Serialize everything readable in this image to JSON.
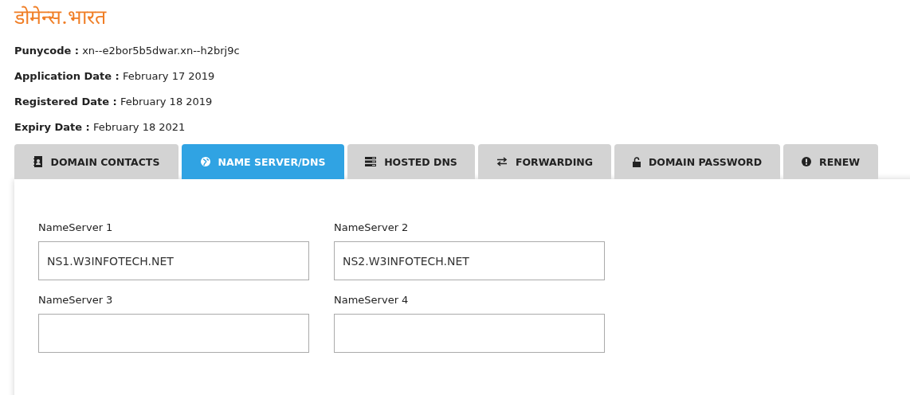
{
  "domain": {
    "title": "डोमेन्स.भारत",
    "details": [
      {
        "label": "Punycode :",
        "value": "xn--e2bor5b5dwar.xn--h2brj9c"
      },
      {
        "label": "Application Date :",
        "value": "February 17 2019"
      },
      {
        "label": "Registered Date :",
        "value": "February 18 2019"
      },
      {
        "label": "Expiry Date :",
        "value": "February 18 2021"
      }
    ]
  },
  "tabs": [
    {
      "label": "DOMAIN CONTACTS",
      "selected": false
    },
    {
      "label": "NAME SERVER/DNS",
      "selected": true
    },
    {
      "label": "HOSTED DNS",
      "selected": false
    },
    {
      "label": "FORWARDING",
      "selected": false
    },
    {
      "label": "DOMAIN PASSWORD",
      "selected": false
    },
    {
      "label": "RENEW",
      "selected": false
    }
  ],
  "nameservers": [
    {
      "label": "NameServer 1",
      "value": "NS1.W3INFOTECH.NET"
    },
    {
      "label": "NameServer 2",
      "value": "NS2.W3INFOTECH.NET"
    },
    {
      "label": "NameServer 3"
    },
    {
      "label": "NameServer 4"
    }
  ]
}
